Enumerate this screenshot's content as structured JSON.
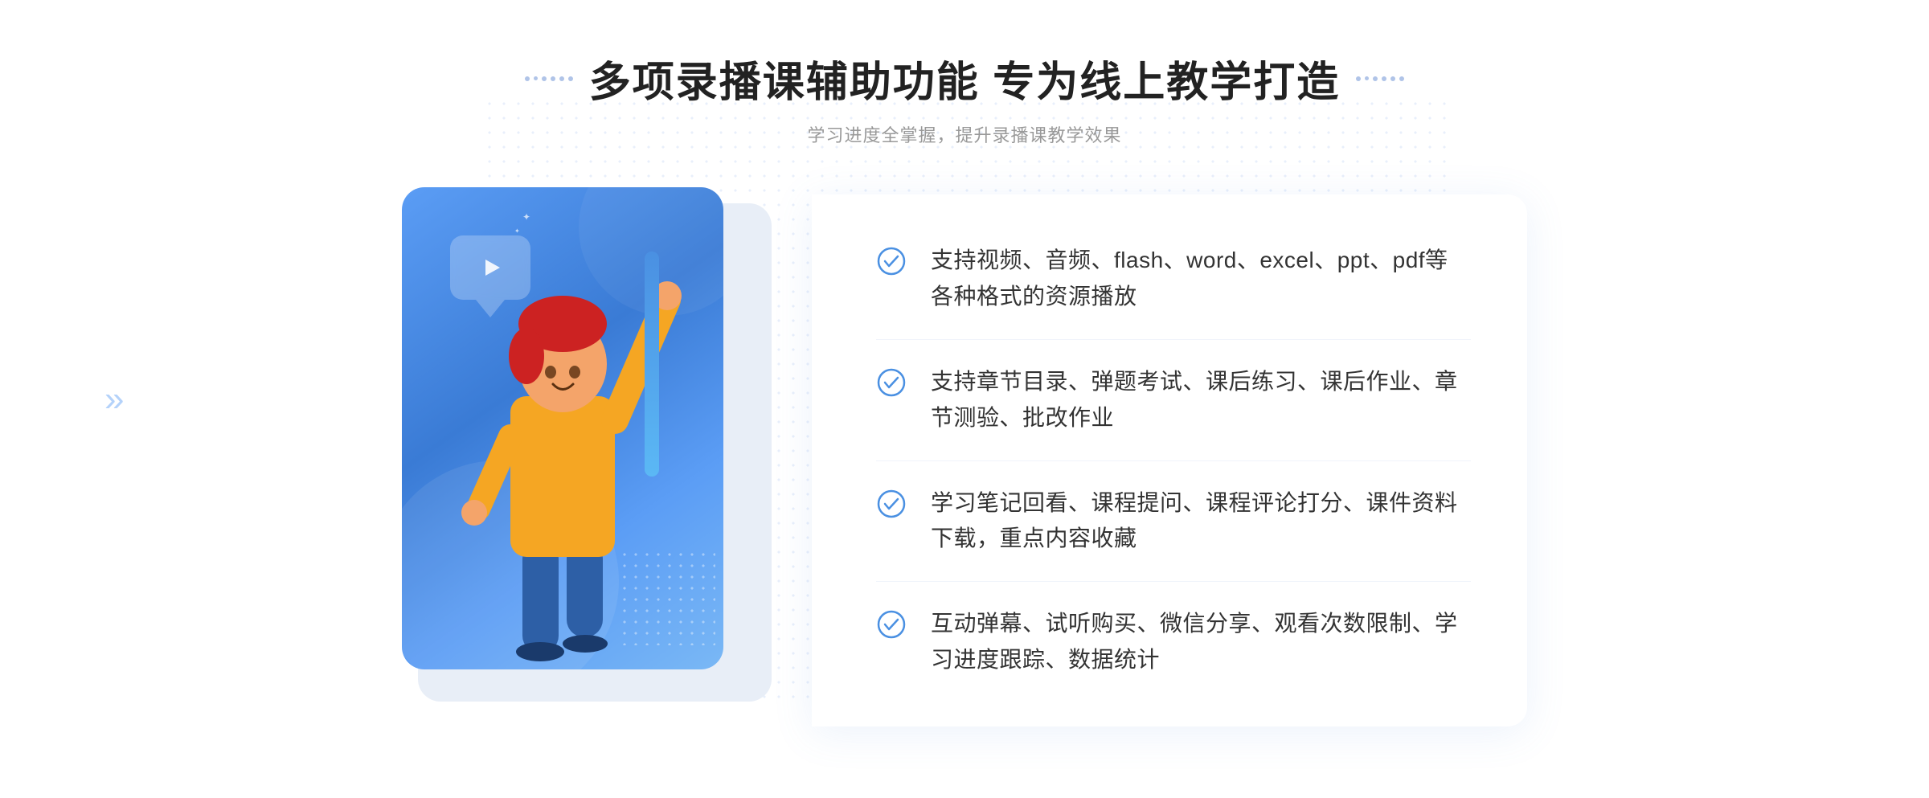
{
  "header": {
    "main_title": "多项录播课辅助功能 专为线上教学打造",
    "sub_title": "学习进度全掌握，提升录播课教学效果"
  },
  "features": [
    {
      "id": "feature-1",
      "text": "支持视频、音频、flash、word、excel、ppt、pdf等各种格式的资源播放"
    },
    {
      "id": "feature-2",
      "text": "支持章节目录、弹题考试、课后练习、课后作业、章节测验、批改作业"
    },
    {
      "id": "feature-3",
      "text": "学习笔记回看、课程提问、课程评论打分、课件资料下载，重点内容收藏"
    },
    {
      "id": "feature-4",
      "text": "互动弹幕、试听购买、微信分享、观看次数限制、学习进度跟踪、数据统计"
    }
  ],
  "decorations": {
    "chevron_left": "«",
    "sparkle_char": "✦"
  }
}
